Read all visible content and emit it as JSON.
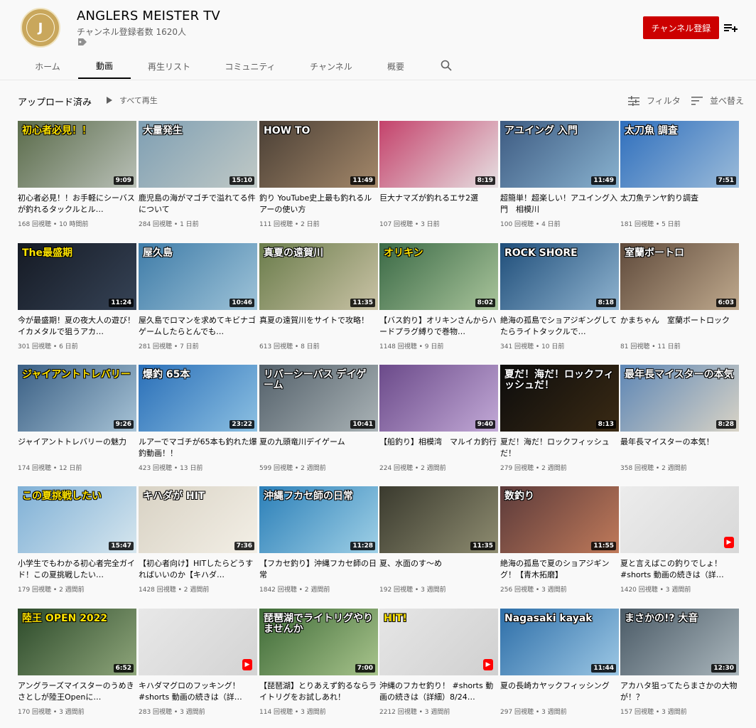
{
  "channel": {
    "name": "ANGLERS MEISTER TV",
    "subscribers": "チャンネル登録者数 1620人",
    "subscribe_label": "チャンネル登録",
    "avatar_letter": "J",
    "brand_color": "#cc0000"
  },
  "tabs": [
    "ホーム",
    "動画",
    "再生リスト",
    "コミュニティ",
    "チャンネル",
    "概要"
  ],
  "section": {
    "title": "アップロード済み",
    "play_all": "すべて再生",
    "filter": "フィルタ",
    "sort": "並べ替え"
  },
  "videos": [
    {
      "title": "初心者必見！！お手軽にシーバスが釣れるタックルとル…",
      "views": "168 回視聴",
      "age": "10 時間前",
      "duration": "9:09",
      "caption": "初心者必見！！",
      "bg": "linear-gradient(135deg,#5a6b4a,#b9c0b7)"
    },
    {
      "title": "鹿児島の海がマゴチで溢れてる件について",
      "views": "284 回視聴",
      "age": "1 日前",
      "duration": "15:10",
      "caption": "大量発生",
      "bg": "linear-gradient(135deg,#7f9fb3,#c0c9c6)"
    },
    {
      "title": "釣り YouTube史上最も釣れるルアーの使い方",
      "views": "111 回視聴",
      "age": "2 日前",
      "duration": "11:49",
      "caption": "HOW TO",
      "bg": "linear-gradient(135deg,#4a3f35,#a4886a)"
    },
    {
      "title": "巨大ナマズが釣れるエサ2選",
      "views": "107 回視聴",
      "age": "3 日前",
      "duration": "8:19",
      "caption": "",
      "bg": "linear-gradient(135deg,#c4426b,#e6e0e2)"
    },
    {
      "title": "超簡単！超楽しい！アユイング入門　相模川",
      "views": "100 回視聴",
      "age": "4 日前",
      "duration": "11:49",
      "caption": "アユイング 入門",
      "bg": "linear-gradient(135deg,#3d5b82,#89b2cf)"
    },
    {
      "title": "太刀魚テンヤ釣り調査",
      "views": "181 回視聴",
      "age": "5 日前",
      "duration": "7:51",
      "caption": "太刀魚 調査",
      "bg": "linear-gradient(135deg,#2f6fbd,#9bbbd9)"
    },
    {
      "title": "今が最盛期！夏の夜大人の遊び！イカメタルで狙うアカ…",
      "views": "301 回視聴",
      "age": "6 日前",
      "duration": "11:24",
      "caption": "The最盛期",
      "bg": "linear-gradient(135deg,#151a24,#364356)"
    },
    {
      "title": "屋久島でロマンを求めてキビナゴゲームしたらとんでも…",
      "views": "281 回視聴",
      "age": "7 日前",
      "duration": "10:46",
      "caption": "屋久島",
      "bg": "linear-gradient(135deg,#3f7ca8,#9ec3d8)"
    },
    {
      "title": "真夏の遠賀川をサイトで攻略！",
      "views": "613 回視聴",
      "age": "8 日前",
      "duration": "11:35",
      "caption": "真夏の遠賀川",
      "bg": "linear-gradient(135deg,#6a7c4b,#cac3a6)"
    },
    {
      "title": "【バス釣り】オリキンさんからハードプラグ縛りで巻物…",
      "views": "1148 回視聴",
      "age": "9 日前",
      "duration": "8:02",
      "caption": "オリキン",
      "bg": "linear-gradient(135deg,#3b6a46,#a9c49b)"
    },
    {
      "title": "絶海の孤島でショアジギングしてたらライトタックルで…",
      "views": "341 回視聴",
      "age": "10 日前",
      "duration": "8:18",
      "caption": "ROCK SHORE",
      "bg": "linear-gradient(135deg,#1f4e7a,#8fb3cf)"
    },
    {
      "title": "かまちゃん　室蘭ボートロック",
      "views": "81 回視聴",
      "age": "11 日前",
      "duration": "6:03",
      "caption": "室蘭ボートロ",
      "bg": "linear-gradient(135deg,#5f4a3b,#bfa98d)"
    },
    {
      "title": "ジャイアントトレバリーの魅力",
      "views": "174 回視聴",
      "age": "12 日前",
      "duration": "9:26",
      "caption": "ジャイアントトレバリー",
      "bg": "linear-gradient(135deg,#3a5f84,#a7c3d6)"
    },
    {
      "title": "ルアーでマゴチが65本も釣れた爆釣動画！！",
      "views": "423 回視聴",
      "age": "13 日前",
      "duration": "23:22",
      "caption": "爆釣 65本",
      "bg": "linear-gradient(135deg,#2a6fb8,#8cc0e2)"
    },
    {
      "title": "夏の九頭竜川デイゲーム",
      "views": "599 回視聴",
      "age": "2 週間前",
      "duration": "10:41",
      "caption": "リバーシーバス デイゲーム",
      "bg": "linear-gradient(135deg,#53606a,#aab3b6)"
    },
    {
      "title": "【船釣り】相模湾　マルイカ釣行",
      "views": "224 回視聴",
      "age": "2 週間前",
      "duration": "9:40",
      "caption": "",
      "bg": "linear-gradient(135deg,#6b4a8a,#c2a9d6)"
    },
    {
      "title": "夏だ！海だ！ロックフィッシュだ！",
      "views": "279 回視聴",
      "age": "2 週間前",
      "duration": "8:13",
      "caption": "夏だ！海だ！ロックフィッシュだ！",
      "bg": "linear-gradient(135deg,#0c0c0c,#3a2a14)"
    },
    {
      "title": "最年長マイスターの本気！",
      "views": "358 回視聴",
      "age": "2 週間前",
      "duration": "8:28",
      "caption": "最年長マイスターの本気",
      "bg": "linear-gradient(135deg,#5d86b5,#d8d3c6)"
    },
    {
      "title": "小学生でもわかる初心者完全ガイド！この夏挑戦したい…",
      "views": "179 回視聴",
      "age": "2 週間前",
      "duration": "15:47",
      "caption": "この夏挑戦したい",
      "bg": "linear-gradient(135deg,#7fb0d6,#d6e6ee)"
    },
    {
      "title": "【初心者向け】HITしたらどうすればいいのか【キハダ…",
      "views": "1428 回視聴",
      "age": "2 週間前",
      "duration": "7:36",
      "caption": "キハダが HIT",
      "bg": "linear-gradient(135deg,#d8d2c4,#f3efe6)"
    },
    {
      "title": "【フカセ釣り】沖縄フカセ師の日常",
      "views": "1842 回視聴",
      "age": "2 週間前",
      "duration": "11:28",
      "caption": "沖縄フカセ師の日常",
      "bg": "linear-gradient(135deg,#2b7fb8,#9fd0e6)"
    },
    {
      "title": "夏、水面のす〜め",
      "views": "192 回視聴",
      "age": "3 週間前",
      "duration": "11:35",
      "caption": "",
      "bg": "linear-gradient(135deg,#3a3a2e,#8e8c70)"
    },
    {
      "title": "絶海の孤島で夏のショアジギング！【青木拓磨】",
      "views": "256 回視聴",
      "age": "3 週間前",
      "duration": "11:55",
      "caption": "数釣り",
      "bg": "linear-gradient(135deg,#5b3a3a,#c07a5a)"
    },
    {
      "title": "夏と言えばこの釣りでしょ！#shorts 動画の続きは（詳…",
      "views": "1420 回視聴",
      "age": "3 週間前",
      "duration": "",
      "caption": "",
      "bg": "linear-gradient(135deg,#ececec,#d8d8d8)"
    },
    {
      "title": "アングラーズマイスターのうめき さとしが陸王Openに…",
      "views": "170 回視聴",
      "age": "3 週間前",
      "duration": "6:52",
      "caption": "陸王 OPEN 2022",
      "bg": "linear-gradient(135deg,#2c4a2a,#8ea57a)"
    },
    {
      "title": "キハダマグロのフッキング！#shorts 動画の続きは（詳…",
      "views": "283 回視聴",
      "age": "3 週間前",
      "duration": "",
      "caption": "",
      "bg": "linear-gradient(135deg,#e8e8e8,#d3d3d3)"
    },
    {
      "title": "【琵琶湖】とりあえず釣るならライトリグをお試しあれ！",
      "views": "114 回視聴",
      "age": "3 週間前",
      "duration": "7:00",
      "caption": "琵琶湖でライトリグやりませんか",
      "bg": "linear-gradient(135deg,#3e6a37,#a8c48c)"
    },
    {
      "title": "沖縄のフカセ釣り！ #shorts 動画の続きは（詳細）8/24…",
      "views": "2212 回視聴",
      "age": "3 週間前",
      "duration": "",
      "caption": "HIT!",
      "bg": "linear-gradient(135deg,#e6e6e6,#d0d0d0)"
    },
    {
      "title": "夏の長崎カヤックフィッシング",
      "views": "297 回視聴",
      "age": "3 週間前",
      "duration": "11:44",
      "caption": "Nagasaki kayak",
      "bg": "linear-gradient(135deg,#2d6ea8,#9cc7e4)"
    },
    {
      "title": "アカハタ狙ってたらまさかの大物が！？",
      "views": "157 回視聴",
      "age": "3 週間前",
      "duration": "12:30",
      "caption": "まさかの!? 大音",
      "bg": "linear-gradient(135deg,#4a5a66,#aab6bc)"
    }
  ]
}
